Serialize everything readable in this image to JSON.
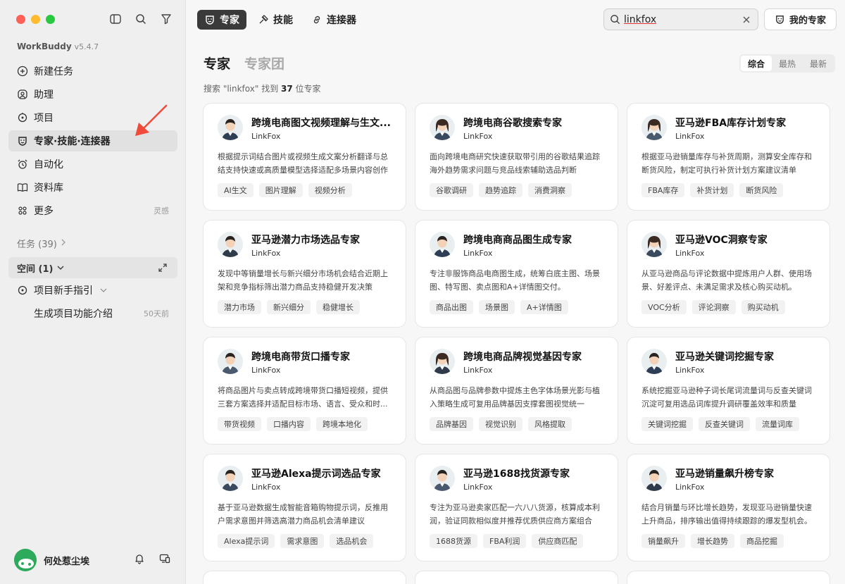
{
  "app": {
    "name": "WorkBuddy",
    "version": "v5.4.7"
  },
  "sidebar": {
    "items": [
      {
        "label": "新建任务",
        "icon": "plus-circle-icon"
      },
      {
        "label": "助理",
        "icon": "assistant-icon"
      },
      {
        "label": "项目",
        "icon": "project-icon"
      },
      {
        "label": "专家·技能·连接器",
        "icon": "expert-icon",
        "active": true
      },
      {
        "label": "自动化",
        "icon": "alarm-clock-icon"
      },
      {
        "label": "资料库",
        "icon": "book-icon"
      },
      {
        "label": "更多",
        "icon": "grid-icon",
        "extra": "灵感"
      }
    ],
    "tasks_label": "任务 (39)",
    "space_label": "空间 (1)",
    "project_label": "项目新手指引",
    "sub_item": {
      "label": "生成项目功能介绍",
      "time": "50天前"
    },
    "user": {
      "name": "何处惹尘埃"
    }
  },
  "tabs": [
    {
      "label": "专家",
      "active": true
    },
    {
      "label": "技能"
    },
    {
      "label": "连接器"
    }
  ],
  "search": {
    "value": "linkfox"
  },
  "my_experts_label": "我的专家",
  "header": {
    "title": "专家",
    "alt": "专家团"
  },
  "sort": [
    "综合",
    "最热",
    "最新"
  ],
  "result": {
    "prefix": "搜索 \"linkfox\" 找到 ",
    "count": "37",
    "suffix": " 位专家"
  },
  "cards": [
    {
      "title": "跨境电商图文视频理解与生文...",
      "brand": "LinkFox",
      "desc": "根据提示词结合图片或视频生成文案分析翻译与总结支持快速或高质量模型选择适配多场景内容创作",
      "tags": [
        "AI生文",
        "图片理解",
        "视频分析"
      ]
    },
    {
      "title": "跨境电商谷歌搜索专家",
      "brand": "LinkFox",
      "desc": "面向跨境电商研究快速获取带引用的谷歌结果追踪海外趋势需求问题与竞品线索辅助选品判断",
      "tags": [
        "谷歌调研",
        "趋势追踪",
        "消费洞察"
      ]
    },
    {
      "title": "亚马逊FBA库存计划专家",
      "brand": "LinkFox",
      "desc": "根据亚马逊销量库存与补货周期，测算安全库存和断货风险，制定可执行补货计划方案建议清单",
      "tags": [
        "FBA库存",
        "补货计划",
        "断货风险"
      ]
    },
    {
      "title": "亚马逊潜力市场选品专家",
      "brand": "LinkFox",
      "desc": "发现中等销量增长与新兴细分市场机会结合近期上架和竞争指标筛出潜力商品支持稳健开发决策",
      "tags": [
        "潜力市场",
        "新兴细分",
        "稳健增长"
      ]
    },
    {
      "title": "跨境电商商品图生成专家",
      "brand": "LinkFox",
      "desc": "专注非服饰商品电商图生成，统筹白底主图、场景图、特写图、卖点图和A+详情图交付。",
      "tags": [
        "商品出图",
        "场景图",
        "A+详情图"
      ]
    },
    {
      "title": "亚马逊VOC洞察专家",
      "brand": "LinkFox",
      "desc": "从亚马逊商品与评论数据中提炼用户人群、使用场景、好差评点、未满足需求及核心购买动机。",
      "tags": [
        "VOC分析",
        "评论洞察",
        "购买动机"
      ]
    },
    {
      "title": "跨境电商带货口播专家",
      "brand": "LinkFox",
      "desc": "将商品图片与卖点转成跨境带货口播短视频，提供三套方案选择并适配目标市场、语言、受众和时...",
      "tags": [
        "带货视频",
        "口播内容",
        "跨境本地化"
      ]
    },
    {
      "title": "跨境电商品牌视觉基因专家",
      "brand": "LinkFox",
      "desc": "从商品图与品牌参数中提炼主色字体场景光影与植入策略生成可复用品牌基因支撑套图视觉统一",
      "tags": [
        "品牌基因",
        "视觉识别",
        "风格提取"
      ]
    },
    {
      "title": "亚马逊关键词挖掘专家",
      "brand": "LinkFox",
      "desc": "系统挖掘亚马逊种子词长尾词流量词与反查关键词沉淀可复用选品词库提升调研覆盖效率和质量",
      "tags": [
        "关键词挖掘",
        "反查关键词",
        "流量词库"
      ]
    },
    {
      "title": "亚马逊Alexa提示词选品专家",
      "brand": "LinkFox",
      "desc": "基于亚马逊数据生成智能音箱购物提示词，反推用户需求意图并筛选高潜力商品机会清单建议",
      "tags": [
        "Alexa提示词",
        "需求意图",
        "选品机会"
      ]
    },
    {
      "title": "亚马逊1688找货源专家",
      "brand": "LinkFox",
      "desc": "专注为亚马逊卖家匹配一六八八货源，核算成本利润，验证同款相似度并推荐优质供应商方案组合",
      "tags": [
        "1688货源",
        "FBA利润",
        "供应商匹配"
      ]
    },
    {
      "title": "亚马逊销量飙升榜专家",
      "brand": "LinkFox",
      "desc": "结合月销量与环比增长趋势，发现亚马逊销量快速上升商品，排序输出值得持续跟踪的爆发型机会。",
      "tags": [
        "销量飙升",
        "增长趋势",
        "商品挖掘"
      ]
    }
  ]
}
